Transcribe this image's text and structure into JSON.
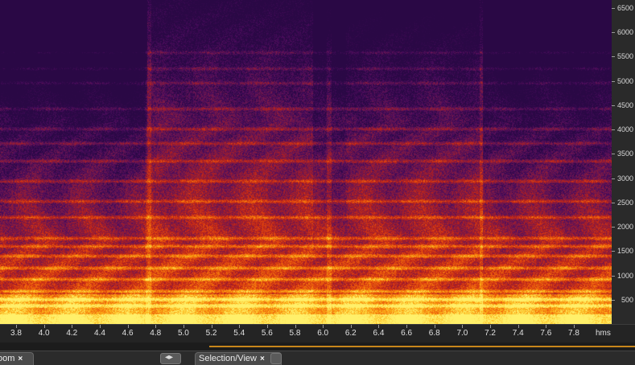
{
  "spectrogram": {
    "palette": [
      "#2a0845",
      "#4b0c5e",
      "#7a1a4a",
      "#b31e1e",
      "#e0420e",
      "#f57a0c",
      "#fcb71a",
      "#fff06a"
    ]
  },
  "freq_ruler": {
    "labels": [
      "6500",
      "6000",
      "5500",
      "5000",
      "4500",
      "4000",
      "3500",
      "3000",
      "2500",
      "2000",
      "1500",
      "1000",
      "500"
    ],
    "values": [
      6500,
      6000,
      5500,
      5000,
      4500,
      4000,
      3500,
      3000,
      2500,
      2000,
      1500,
      1000,
      500
    ]
  },
  "time_ruler": {
    "labels": [
      "3.8",
      "4.0",
      "4.2",
      "4.4",
      "4.6",
      "4.8",
      "5.0",
      "5.2",
      "5.4",
      "5.6",
      "5.8",
      "6.0",
      "6.2",
      "6.4",
      "6.6",
      "6.8",
      "7.0",
      "7.2",
      "7.4",
      "7.6",
      "7.8"
    ],
    "values": [
      3.8,
      4.0,
      4.2,
      4.4,
      4.6,
      4.8,
      5.0,
      5.2,
      5.4,
      5.6,
      5.8,
      6.0,
      6.2,
      6.4,
      6.6,
      6.8,
      7.0,
      7.2,
      7.4,
      7.6,
      7.8
    ],
    "unit": "hms"
  },
  "panel_tabs": {
    "zoom_label": "oom",
    "zoom_close": "×",
    "selection_label": "Selection/View",
    "selection_close": "×",
    "grip_symbol": "◂▸"
  }
}
